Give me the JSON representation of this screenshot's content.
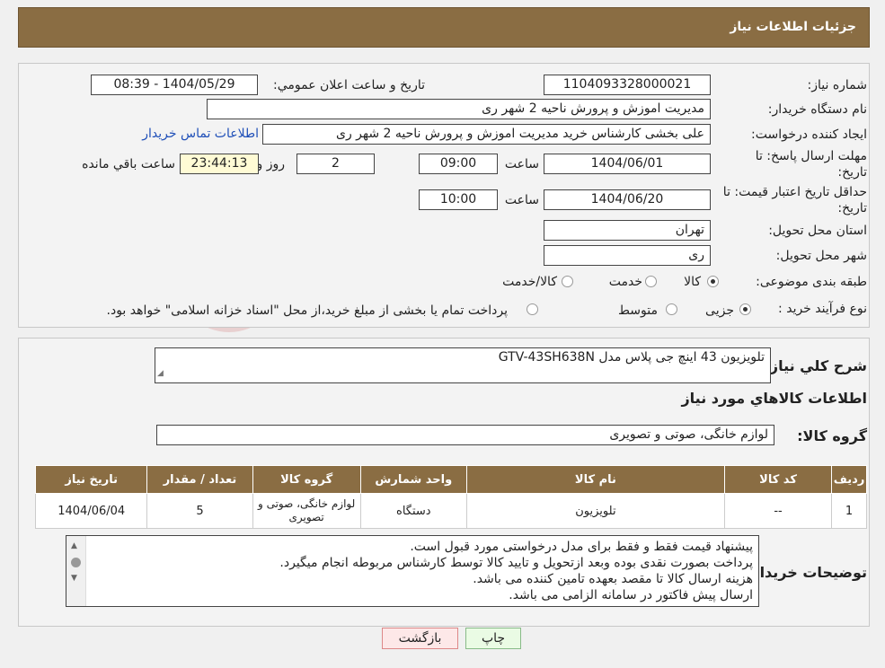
{
  "header": {
    "title": "جزئیات اطلاعات نیاز"
  },
  "watermark": {
    "text": "AriaTender.neT"
  },
  "fields": {
    "need_number_label": "شماره نیاز:",
    "need_number": "1104093328000021",
    "announce_label": "تاريخ و ساعت اعلان عمومي:",
    "announce_value": "1404/05/29 - 08:39",
    "buyer_org_label": "نام دستگاه خریدار:",
    "buyer_org": "مدیریت اموزش و پرورش ناحیه 2 شهر ری",
    "creator_label": "ایجاد کننده درخواست:",
    "creator": "علی بخشی کارشناس خرید مدیریت اموزش و پرورش ناحیه 2 شهر ری",
    "contact_link": "اطلاعات تماس خریدار",
    "deadline_label_1": "مهلت ارسال پاسخ: تا",
    "deadline_label_2": "تاریخ:",
    "deadline_date": "1404/06/01",
    "time_label": "ساعت",
    "deadline_time": "09:00",
    "days_value": "2",
    "days_label": "روز و",
    "remaining_value": "23:44:13",
    "remaining_label": "ساعت باقي مانده",
    "validity_label_1": "حداقل تاریخ اعتبار قیمت: تا",
    "validity_label_2": "تاریخ:",
    "validity_date": "1404/06/20",
    "validity_time": "10:00",
    "province_label": "استان محل تحویل:",
    "province": "تهران",
    "city_label": "شهر محل تحویل:",
    "city": "ری",
    "category_label": "طبقه بندی موضوعی:",
    "category_options": [
      "کالا",
      "خدمت",
      "کالا/خدمت"
    ],
    "purchase_type_label": "نوع فرآیند خرید :",
    "purchase_options": [
      "جزیی",
      "متوسط"
    ],
    "purchase_note": "پرداخت تمام یا بخشی از مبلغ خرید،از محل \"اسناد خزانه اسلامی\" خواهد بود."
  },
  "summary": {
    "label": "شرح كلي نياز:",
    "value": "تلویزیون 43 اینچ جی پلاس مدل GTV-43SH638N"
  },
  "goods_section": {
    "title": "اطلاعات كالاهاي مورد نياز",
    "group_label": "گروه کالا:",
    "group_value": "لوازم خانگی، صوتی و تصویری"
  },
  "table": {
    "headers": [
      "ردیف",
      "کد کالا",
      "نام کالا",
      "واحد شمارش",
      "گروه کالا",
      "تعداد / مقدار",
      "تاریخ نیاز"
    ],
    "rows": [
      [
        "1",
        "--",
        "تلویزیون",
        "دستگاه",
        "لوازم خانگی، صوتی و تصویری",
        "5",
        "1404/06/04"
      ]
    ]
  },
  "notes": {
    "label": "توضیحات خریدار:",
    "lines": [
      "پیشنهاد قیمت فقط و فقط برای مدل درخواستی مورد قبول است.",
      "پرداخت بصورت نقدی بوده وبعد ازتحویل و تایید کالا توسط کارشناس مربوطه انجام میگیرد.",
      "هزینه ارسال کالا تا مقصد بعهده تامین کننده می باشد.",
      "ارسال پیش فاکتور در سامانه الزامی می باشد."
    ]
  },
  "buttons": {
    "back": "بازگشت",
    "print": "چاپ"
  },
  "colors": {
    "header_bg": "#8a6d43",
    "back_btn_bg": "#fde8e8",
    "print_btn_bg": "#eafbe4",
    "remaining_bg": "#fffbd5"
  }
}
